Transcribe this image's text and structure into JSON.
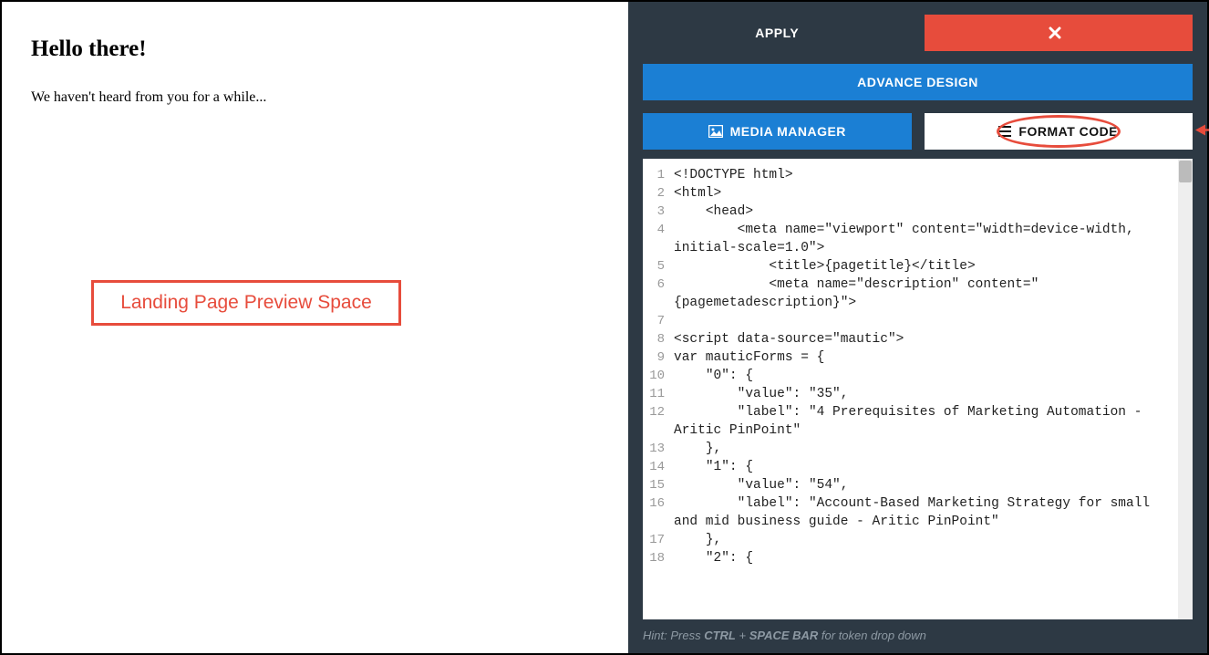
{
  "preview": {
    "title": "Hello there!",
    "body": "We haven't heard from you for a while...",
    "annotation": "Landing Page Preview Space"
  },
  "toolbar": {
    "apply_label": "APPLY",
    "close_icon": "close-icon",
    "advance_design_label": "ADVANCE DESIGN",
    "media_manager_label": "MEDIA MANAGER",
    "format_code_label": "FORMAT CODE"
  },
  "editor": {
    "lines": [
      "<!DOCTYPE html>",
      "<html>",
      "    <head>",
      "        <meta name=\"viewport\" content=\"width=device-width, initial-scale=1.0\">",
      "            <title>{pagetitle}</title>",
      "            <meta name=\"description\" content=\"{pagemetadescription}\">",
      "",
      "<script data-source=\"mautic\">",
      "var mauticForms = {",
      "    \"0\": {",
      "        \"value\": \"35\",",
      "        \"label\": \"4 Prerequisites of Marketing Automation - Aritic PinPoint\"",
      "    },",
      "    \"1\": {",
      "        \"value\": \"54\",",
      "        \"label\": \"Account-Based Marketing Strategy for small and mid business guide - Aritic PinPoint\"",
      "    },",
      "    \"2\": {"
    ]
  },
  "hint": {
    "prefix": "Hint: Press ",
    "key1": "CTRL",
    "plus": " + ",
    "key2": "SPACE BAR",
    "suffix": " for token drop down"
  },
  "colors": {
    "panel": "#2d3944",
    "blue": "#1b7fd4",
    "red": "#e74c3c"
  }
}
